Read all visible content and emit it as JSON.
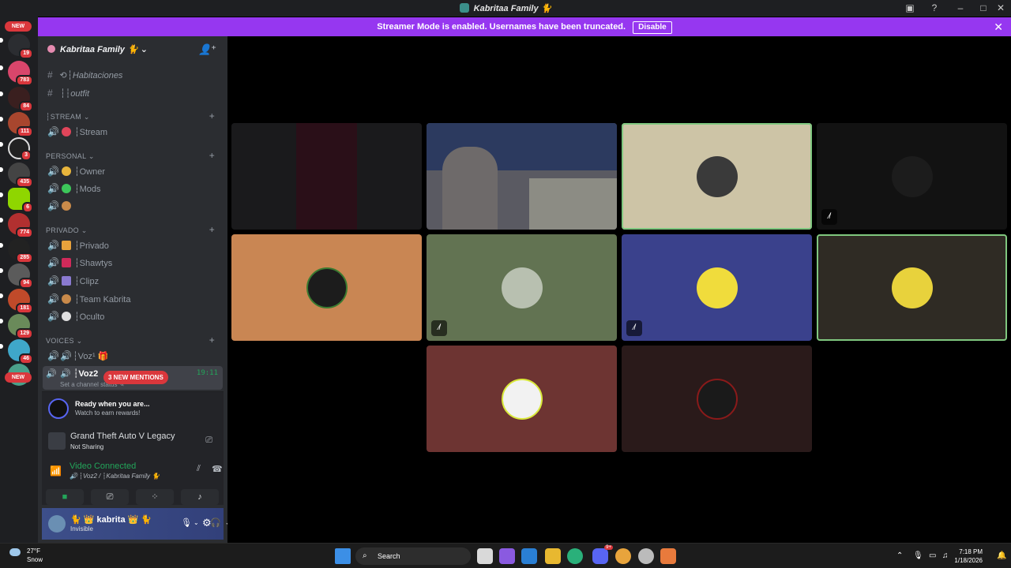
{
  "window": {
    "title": "Kabritaa Family 🐈"
  },
  "banner": {
    "message": "Streamer Mode is enabled. Usernames have been truncated.",
    "disable_label": "Disable",
    "close_label": "✕"
  },
  "servers": {
    "top_pill": "NEW",
    "bottom_pill": "NEW",
    "badges": [
      "19",
      "783",
      "84",
      "111",
      "3",
      "435",
      "6",
      "774",
      "285",
      "94",
      "181",
      "129",
      "46"
    ]
  },
  "guild": {
    "name": "Kabritaa Family 🐈",
    "chevron": "⌄"
  },
  "channels": {
    "text": [
      {
        "name": "⟲┆Habitaciones"
      },
      {
        "name": "┆┆outfit"
      }
    ],
    "categories": [
      {
        "label": "┆STREAM ⌄",
        "voice": [
          {
            "name": "┆Stream"
          }
        ]
      },
      {
        "label": "PERSONAL ⌄",
        "voice": [
          {
            "name": "┆Owner"
          },
          {
            "name": "┆Mods"
          },
          {
            "name": ""
          }
        ]
      },
      {
        "label": "PRIVADO ⌄",
        "voice": [
          {
            "name": "┆Privado"
          },
          {
            "name": "┆Shawtys"
          },
          {
            "name": "┆Clipz"
          },
          {
            "name": "┆Team Kabrita"
          },
          {
            "name": "┆Oculto"
          }
        ]
      },
      {
        "label": "VOICES ⌄",
        "voice": [
          {
            "name": "┆Voz¹ 🎁"
          }
        ]
      }
    ],
    "active_voice": {
      "name": "┆Voz2",
      "status": "Set a channel status ✎",
      "timer": "19:11",
      "mentions": "3 NEW MENTIONS"
    }
  },
  "reward": {
    "title": "Ready when you are...",
    "subtitle": "Watch to earn rewards!"
  },
  "activity": {
    "game": "Grand Theft Auto V Legacy",
    "status": "Not Sharing"
  },
  "rtc": {
    "status": "Video Connected",
    "location": "🔊 ┆Voz2 / ┆Kabritaa Family 🐈"
  },
  "user": {
    "name": "🐈 👑 kabrita 👑 🐈",
    "status": "Invisible"
  },
  "taskbar": {
    "temperature": "27°F",
    "condition": "Snow",
    "search_placeholder": "Search",
    "time": "7:18 PM",
    "date": "1/18/2026",
    "discord_badge": "9+"
  },
  "colors": {
    "banner": "#9637f0",
    "mention": "#da373c",
    "connected": "#23a55a",
    "speaking_outline": "#7fc77f"
  }
}
